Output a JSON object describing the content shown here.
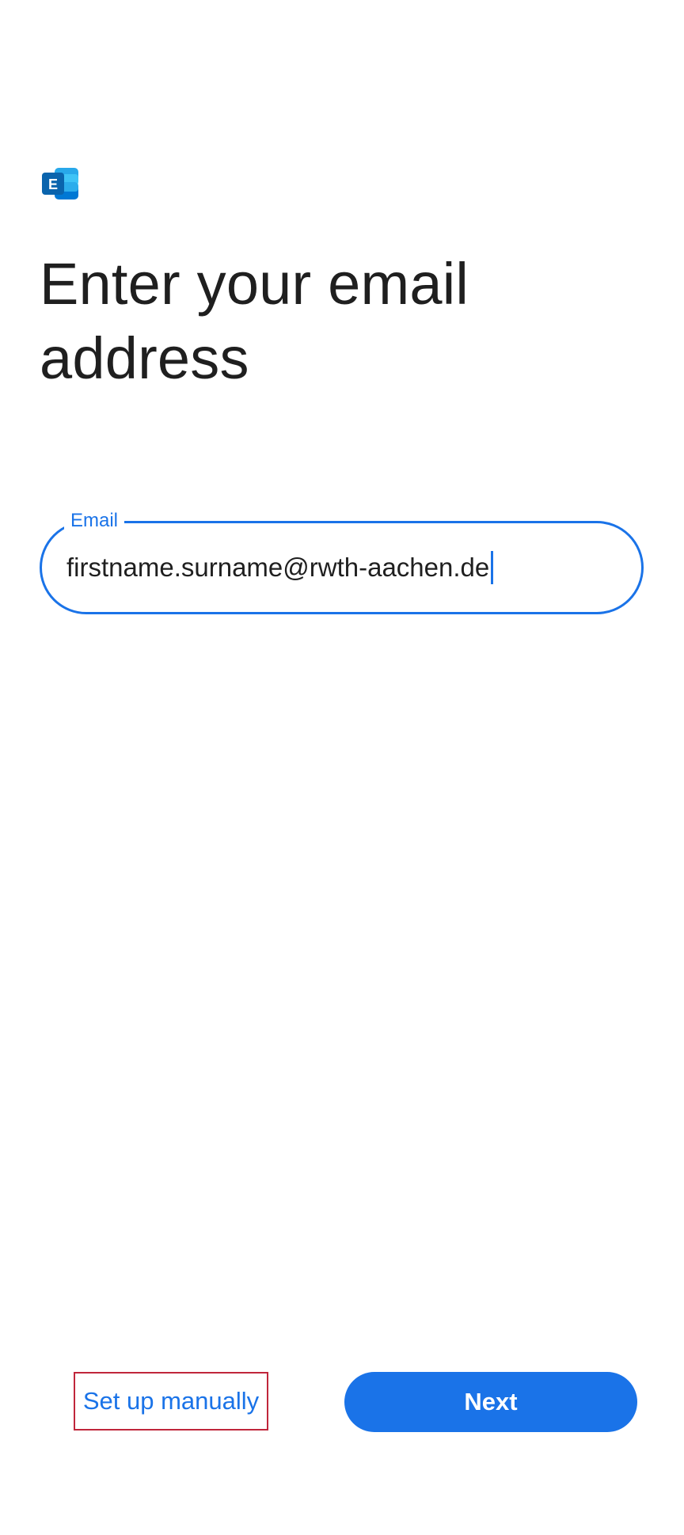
{
  "app": {
    "logo_icon": "exchange-icon",
    "logo_letter": "E"
  },
  "page": {
    "title": "Enter your email address"
  },
  "email": {
    "label": "Email",
    "value": "firstname.surname@rwth-aachen.de"
  },
  "actions": {
    "setup_manual_label": "Set up manually",
    "next_label": "Next"
  },
  "colors": {
    "accent": "#1a73e8",
    "highlight_border": "#c0263b",
    "text": "#1f1f1f",
    "background": "#ffffff"
  }
}
